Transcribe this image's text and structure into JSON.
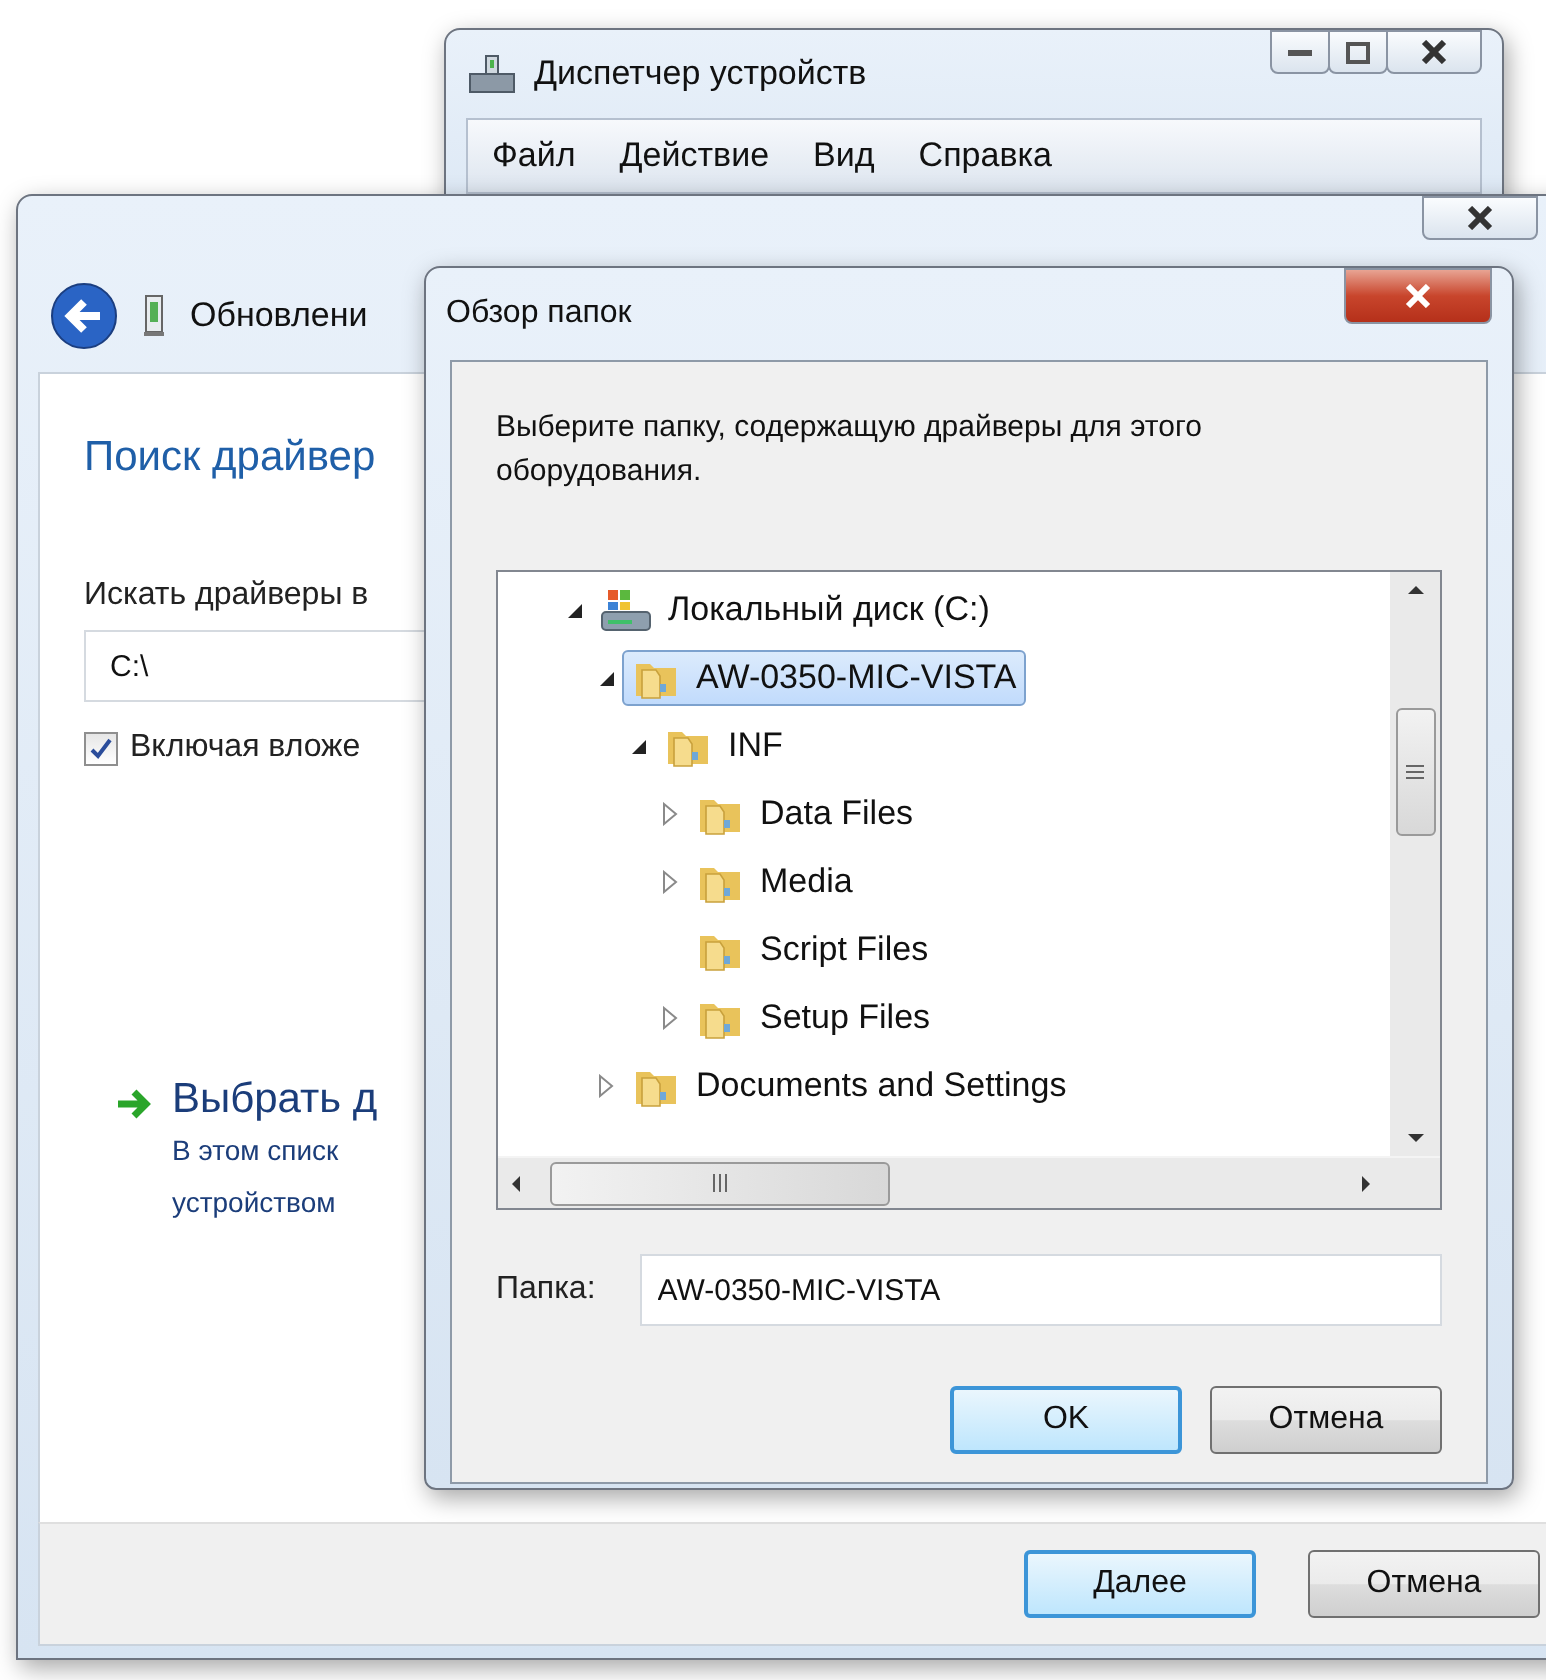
{
  "device_manager": {
    "title": "Диспетчер устройств",
    "menu": [
      {
        "label": "Файл"
      },
      {
        "label": "Действие"
      },
      {
        "label": "Вид"
      },
      {
        "label": "Справка"
      }
    ]
  },
  "wizard": {
    "title": "Обновлени",
    "heading": "Поиск драйвер",
    "path_label": "Искать драйверы в",
    "path_value": "C:\\",
    "include_subfolders": {
      "label": "Включая вложе",
      "checked": true
    },
    "manual_option": {
      "title": "Выбрать д",
      "description_lines": [
        "В этом списк",
        "устройством"
      ]
    },
    "buttons": [
      {
        "label": "Далее",
        "default": true
      },
      {
        "label": "Отмена",
        "default": false
      }
    ]
  },
  "browse_dialog": {
    "title": "Обзор папок",
    "prompt": "Выберите папку, содержащую драйверы для этого оборудования.",
    "tree": [
      {
        "label": "Локальный диск (C:)",
        "kind": "drive",
        "expandable": true,
        "expanded": true,
        "selected": false,
        "children": [
          {
            "label": "AW-0350-MIC-VISTA",
            "kind": "folder",
            "expandable": true,
            "expanded": true,
            "selected": true,
            "children": [
              {
                "label": "INF",
                "kind": "folder",
                "expandable": true,
                "expanded": true,
                "selected": false,
                "children": [
                  {
                    "label": "Data Files",
                    "kind": "folder",
                    "expandable": true,
                    "expanded": false,
                    "selected": false
                  },
                  {
                    "label": "Media",
                    "kind": "folder",
                    "expandable": true,
                    "expanded": false,
                    "selected": false
                  },
                  {
                    "label": "Script Files",
                    "kind": "folder",
                    "expandable": false,
                    "selected": false
                  },
                  {
                    "label": "Setup Files",
                    "kind": "folder",
                    "expandable": true,
                    "expanded": false,
                    "selected": false
                  }
                ]
              }
            ]
          },
          {
            "label": "Documents and Settings",
            "kind": "folder",
            "expandable": true,
            "expanded": false,
            "selected": false
          }
        ]
      }
    ],
    "folder_label": "Папка:",
    "folder_value": "AW-0350-MIC-VISTA",
    "buttons": [
      {
        "label": "OK",
        "default": true
      },
      {
        "label": "Отмена",
        "default": false
      }
    ]
  }
}
